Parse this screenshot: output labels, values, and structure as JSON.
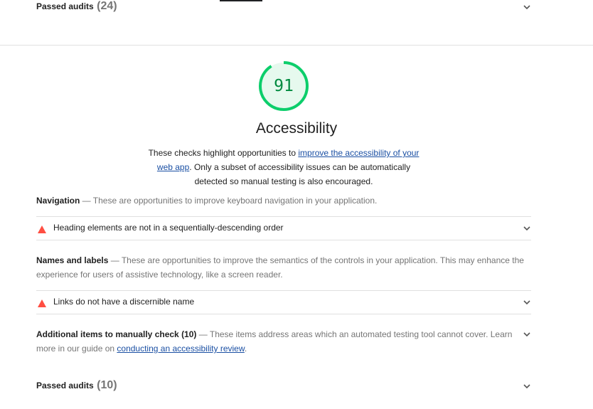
{
  "passed_top": {
    "label": "Passed audits",
    "count": "(24)"
  },
  "category": {
    "score": "91",
    "score_fraction": 0.91,
    "title": "Accessibility",
    "desc_before": "These checks highlight opportunities to ",
    "desc_link": "improve the accessibility of your web app",
    "desc_after": ". Only a subset of accessibility issues can be automatically detected so manual testing is also encouraged."
  },
  "groups": [
    {
      "title": "Navigation",
      "sep": " — ",
      "desc": "These are opportunities to improve keyboard navigation in your application."
    },
    {
      "title": "Names and labels",
      "sep": " — ",
      "desc": "These are opportunities to improve the semantics of the controls in your application. This may enhance the experience for users of assistive technology, like a screen reader."
    }
  ],
  "audits": [
    {
      "label": "Heading elements are not in a sequentially-descending order"
    },
    {
      "label": "Links do not have a discernible name"
    }
  ],
  "manual": {
    "title": "Additional items to manually check",
    "count": "(10)",
    "desc_before": "— These items address areas which an automated testing tool cannot cover. Learn more in our guide on ",
    "link": "conducting an accessibility review",
    "desc_after": "."
  },
  "passed_bottom": {
    "label": "Passed audits",
    "count": "(10)"
  },
  "colors": {
    "pass": "#0cce6b",
    "pass_bg": "#e6f9ee",
    "fail": "#ff4e42",
    "link": "#1a4fa3"
  }
}
